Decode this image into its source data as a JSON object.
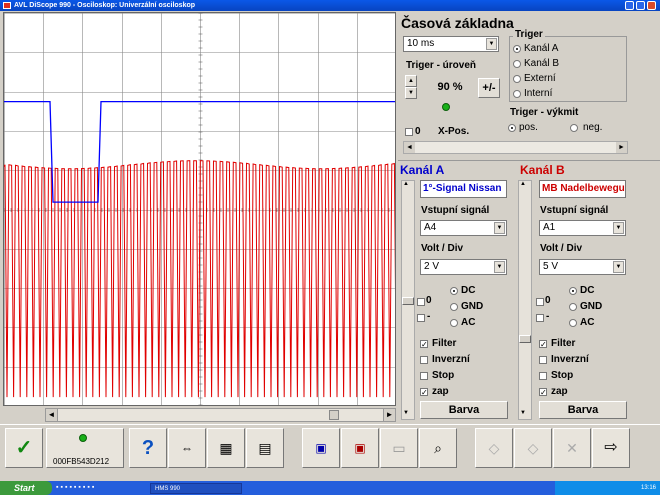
{
  "window": {
    "title": "AVL DiScope 990 - Osciloskop: Univerzální osciloskop"
  },
  "timebase": {
    "heading": "Časová základna",
    "value": "10 ms",
    "trigger_level_label": "Triger - úroveň",
    "trigger_level_value": "90 %",
    "plusminus_label": "+/-",
    "xpos_zero_label": "0",
    "xpos_label": "X-Pos."
  },
  "trigger": {
    "heading": "Triger",
    "options": [
      "Kanál A",
      "Kanál B",
      "Externí",
      "Interní"
    ],
    "selected": "Kanál A",
    "edge_heading": "Triger - výkmit",
    "edge_options": [
      "pos.",
      "neg."
    ],
    "edge_selected": "pos."
  },
  "channel_a": {
    "heading": "Kanál A",
    "signal_name": "1°-Signal Nissan",
    "input_label": "Vstupní signál",
    "input_value": "A4",
    "volt_label": "Volt / Div",
    "volt_value": "2 V",
    "coupling": [
      "DC",
      "GND",
      "AC"
    ],
    "coupling_selected": "DC",
    "offset_zero": "0",
    "offset_minus": "-",
    "checks": [
      {
        "label": "Filter",
        "checked": true
      },
      {
        "label": "Inverzní",
        "checked": false
      },
      {
        "label": "Stop",
        "checked": false
      },
      {
        "label": "zap",
        "checked": true
      }
    ],
    "color_button": "Barva",
    "color": "#0000cc"
  },
  "channel_b": {
    "heading": "Kanál B",
    "signal_name": "MB Nadelbewegung",
    "input_label": "Vstupní signál",
    "input_value": "A1",
    "volt_label": "Volt / Div",
    "volt_value": "5 V",
    "coupling": [
      "DC",
      "GND",
      "AC"
    ],
    "coupling_selected": "DC",
    "offset_zero": "0",
    "offset_minus": "-",
    "checks": [
      {
        "label": "Filter",
        "checked": true
      },
      {
        "label": "Inverzní",
        "checked": false
      },
      {
        "label": "Stop",
        "checked": false
      },
      {
        "label": "zap",
        "checked": true
      }
    ],
    "color_button": "Barva",
    "color": "#cc0000"
  },
  "toolbar": {
    "device_id": "000FB543D212",
    "help_label": "?",
    "icons": [
      "ok-check-icon",
      "device-status-icon",
      "help-icon",
      "scale-icon",
      "save-icon",
      "print-icon",
      "save-channel-a-icon",
      "save-channel-b-icon",
      "blank-page-icon",
      "zoom-icon",
      "prev-marker-icon",
      "next-marker-icon",
      "disabled-cross-icon",
      "exit-icon"
    ]
  },
  "taskbar": {
    "start_label": "Start",
    "window_item": "HMS 990",
    "clock": "13:16"
  },
  "colors": {
    "trace_a": "#0000ff",
    "trace_b": "#e00000",
    "grid": "#000000",
    "panel_bg": "#d4d0c8"
  }
}
